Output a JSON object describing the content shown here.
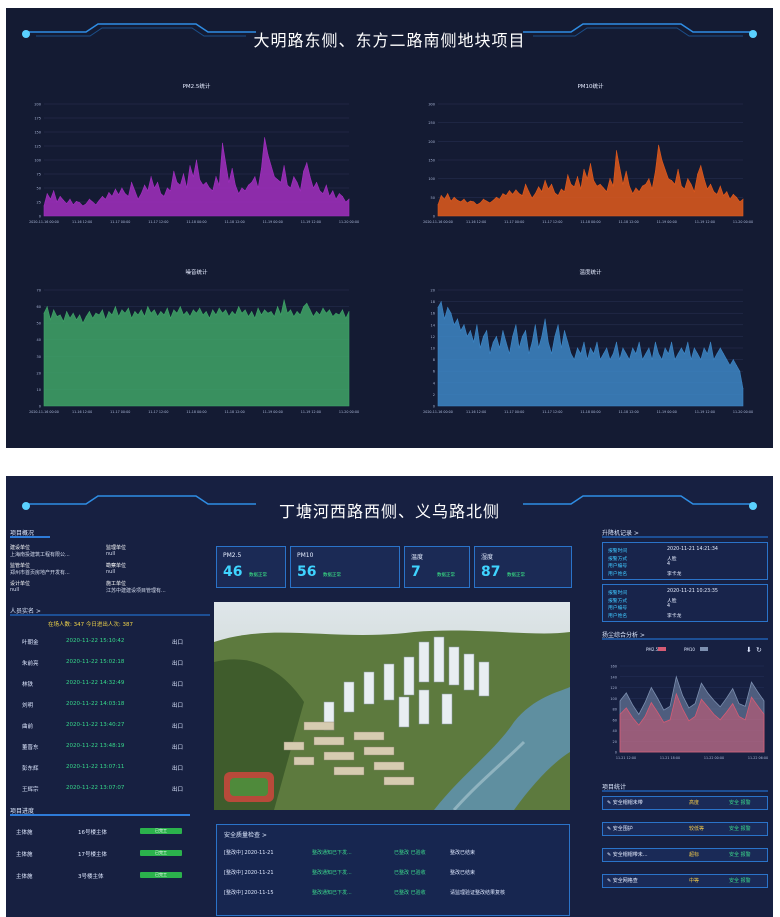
{
  "panel1": {
    "title": "大明路东侧、东方二路南侧地块项目",
    "charts": [
      {
        "title": "PM2.5统计",
        "color": "#a22fc0",
        "ylim": [
          0,
          200
        ],
        "yticks": [
          "0",
          "25",
          "50",
          "75",
          "100",
          "125",
          "150",
          "175",
          "200"
        ],
        "xticks": [
          "2020-11-16 00:00",
          "11-16 12:00",
          "11-17 00:00",
          "11-17 12:00",
          "11-18 00:00",
          "11-18 12:00",
          "11-19 00:00",
          "11-19 12:00",
          "11-20 00:00"
        ],
        "values": [
          18,
          40,
          30,
          45,
          25,
          35,
          28,
          22,
          30,
          20,
          26,
          24,
          18,
          22,
          30,
          25,
          20,
          28,
          35,
          30,
          42,
          35,
          48,
          38,
          50,
          40,
          35,
          60,
          45,
          30,
          40,
          55,
          45,
          70,
          50,
          60,
          40,
          35,
          50,
          45,
          80,
          60,
          55,
          75,
          50,
          90,
          70,
          100,
          65,
          55,
          60,
          50,
          45,
          70,
          55,
          130,
          95,
          60,
          85,
          55,
          40,
          50,
          45,
          55,
          60,
          70,
          50,
          85,
          140,
          110,
          90,
          70,
          65,
          60,
          90,
          55,
          50,
          70,
          60,
          45,
          80,
          95,
          70,
          50,
          60,
          45,
          40,
          55,
          35,
          45,
          30,
          40,
          35,
          25,
          30
        ]
      },
      {
        "title": "PM10统计",
        "color": "#e25a1c",
        "ylim": [
          0,
          300
        ],
        "yticks": [
          "0",
          "50",
          "100",
          "150",
          "200",
          "250",
          "300"
        ],
        "xticks": [
          "2020-11-16 00:00",
          "11-16 12:00",
          "11-17 00:00",
          "11-17 12:00",
          "11-18 00:00",
          "11-18 12:00",
          "11-19 00:00",
          "11-19 12:00",
          "11-20 00:00"
        ],
        "values": [
          30,
          55,
          45,
          60,
          40,
          50,
          42,
          38,
          45,
          35,
          40,
          38,
          30,
          35,
          45,
          40,
          35,
          42,
          50,
          45,
          60,
          55,
          68,
          58,
          70,
          60,
          55,
          85,
          65,
          48,
          60,
          78,
          65,
          95,
          72,
          85,
          62,
          55,
          72,
          65,
          110,
          85,
          78,
          105,
          72,
          125,
          100,
          140,
          95,
          80,
          85,
          75,
          65,
          100,
          80,
          175,
          130,
          85,
          120,
          80,
          60,
          75,
          65,
          80,
          85,
          100,
          72,
          120,
          190,
          150,
          125,
          100,
          95,
          85,
          125,
          80,
          72,
          100,
          85,
          65,
          112,
          135,
          100,
          72,
          85,
          65,
          58,
          80,
          55,
          65,
          45,
          58,
          50,
          38,
          45
        ]
      },
      {
        "title": "噪音统计",
        "color": "#3fa567",
        "ylim": [
          0,
          70
        ],
        "yticks": [
          "0",
          "10",
          "20",
          "30",
          "40",
          "50",
          "60",
          "70"
        ],
        "xticks": [
          "2020-11-16 00:00",
          "11-16 12:00",
          "11-17 00:00",
          "11-17 12:00",
          "11-18 00:00",
          "11-18 12:00",
          "11-19 00:00",
          "11-19 12:00",
          "11-20 00:00"
        ],
        "values": [
          56,
          60,
          52,
          58,
          54,
          55,
          51,
          57,
          53,
          56,
          52,
          55,
          50,
          54,
          57,
          53,
          56,
          55,
          58,
          52,
          57,
          55,
          60,
          54,
          58,
          56,
          59,
          53,
          57,
          55,
          58,
          54,
          60,
          56,
          58,
          54,
          57,
          55,
          59,
          53,
          58,
          56,
          60,
          55,
          57,
          54,
          58,
          56,
          59,
          55,
          57,
          53,
          58,
          55,
          59,
          56,
          58,
          54,
          57,
          55,
          60,
          56,
          58,
          54,
          57,
          53,
          59,
          55,
          58,
          56,
          57,
          54,
          60,
          55,
          64,
          56,
          58,
          54,
          57,
          55,
          60,
          62,
          58,
          54,
          57,
          55,
          59,
          56,
          58,
          54,
          56,
          55,
          58,
          53,
          57
        ]
      },
      {
        "title": "温度统计",
        "color": "#3d86c6",
        "ylim": [
          0,
          20
        ],
        "yticks": [
          "0",
          "2",
          "4",
          "6",
          "8",
          "10",
          "12",
          "14",
          "16",
          "18",
          "20"
        ],
        "xticks": [
          "2020-11-16 00:00",
          "11-16 12:00",
          "11-17 00:00",
          "11-17 12:00",
          "11-18 00:00",
          "11-18 12:00",
          "11-19 00:00",
          "11-19 12:00",
          "11-20 00:00"
        ],
        "values": [
          17,
          18,
          15,
          17,
          16,
          14,
          15,
          13,
          14,
          12,
          13,
          11,
          14,
          10,
          12,
          13,
          9,
          11,
          12,
          10,
          13,
          11,
          9,
          12,
          14,
          10,
          12,
          13,
          9,
          11,
          14,
          10,
          12,
          15,
          11,
          9,
          12,
          14,
          10,
          13,
          11,
          9,
          8,
          10,
          9,
          11,
          8,
          10,
          9,
          11,
          8,
          9,
          10,
          8,
          9,
          11,
          8,
          10,
          9,
          8,
          10,
          9,
          11,
          8,
          9,
          10,
          8,
          11,
          9,
          8,
          10,
          9,
          11,
          8,
          9,
          10,
          9,
          11,
          8,
          10,
          9,
          8,
          10,
          9,
          11,
          8,
          9,
          10,
          9,
          8,
          7,
          8,
          7,
          6,
          3
        ]
      }
    ]
  },
  "panel2": {
    "title": "丁塘河西路西侧、义乌路北侧",
    "overview": {
      "heading": "项目概况",
      "fields": [
        {
          "label": "建设单位",
          "value": "上海南投建筑工程有限公..."
        },
        {
          "label": "监理单位",
          "value": "null"
        },
        {
          "label": "监管单位",
          "value": "郑州市首页房地产开发有..."
        },
        {
          "label": "勘察单位",
          "value": "null"
        },
        {
          "label": "设计单位",
          "value": "null"
        },
        {
          "label": "施工单位",
          "value": "江苏中建建设项目管理有..."
        }
      ]
    },
    "attendance": {
      "heading": "人员实名 >",
      "summary": "在场人数: 347  今日进出人次: 387",
      "rows": [
        {
          "name": "叶朝金",
          "time": "2020-11-22 15:10:42",
          "dir": "出口"
        },
        {
          "name": "朱前亮",
          "time": "2020-11-22 15:02:18",
          "dir": "出口"
        },
        {
          "name": "林铁",
          "time": "2020-11-22 14:32:49",
          "dir": "出口"
        },
        {
          "name": "刘明",
          "time": "2020-11-22 14:03:18",
          "dir": "出口"
        },
        {
          "name": "曲前",
          "time": "2020-11-22 13:40:27",
          "dir": "出口"
        },
        {
          "name": "董晋东",
          "time": "2020-11-22 13:48:19",
          "dir": "出口"
        },
        {
          "name": "彭东辉",
          "time": "2020-11-22 13:07:11",
          "dir": "出口"
        },
        {
          "name": "王辉宗",
          "time": "2020-11-22 13:07:07",
          "dir": "出口"
        }
      ]
    },
    "progress": {
      "heading": "项目进度",
      "rows": [
        {
          "name": "主体施",
          "item": "16号楼主体",
          "status": "已完工"
        },
        {
          "name": "主体施",
          "item": "17号楼主体",
          "status": "已完工"
        },
        {
          "name": "主体施",
          "item": "3号楼主体",
          "status": "已完工"
        }
      ]
    },
    "stats": [
      {
        "name": "PM2.5",
        "value": "46",
        "tag": "数据正常"
      },
      {
        "name": "PM10",
        "value": "56",
        "tag": "数据正常"
      },
      {
        "name": "温度",
        "value": "7",
        "tag": "数据正常"
      },
      {
        "name": "湿度",
        "value": "87",
        "tag": "数据正常"
      }
    ],
    "safety": {
      "heading": "安全质量检查 >",
      "rows": [
        {
          "date": "[整改中] 2020-11-21",
          "desc": "整改通知已下发...",
          "status": "已整改 已验收",
          "result": "整改已结束"
        },
        {
          "date": "[整改中] 2020-11-21",
          "desc": "整改通知已下发...",
          "status": "已整改 已验收",
          "result": "整改已结束"
        },
        {
          "date": "[整改中] 2020-11-15",
          "desc": "整改通知已下发...",
          "status": "已整改 已验收",
          "result": "请监理验证整改结果复核"
        }
      ]
    },
    "alarm": {
      "heading": "升降机记录 >",
      "records": [
        {
          "labels": [
            "报警时间",
            "报警方式",
            "用户编号",
            "用户姓名"
          ],
          "values": [
            "2020-11-21 14:21:34",
            "人脸",
            "4",
            "李卡龙"
          ]
        },
        {
          "labels": [
            "报警时间",
            "报警方式",
            "用户编号",
            "用户姓名"
          ],
          "values": [
            "2020-11-21 10:23:35",
            "人脸",
            "4",
            "李卡龙"
          ]
        }
      ]
    },
    "dust": {
      "heading": "扬尘综合分析 >",
      "legend": [
        "PM2.5",
        "PM10"
      ],
      "legend_colors": [
        "#d65b74",
        "#7c8fb0"
      ],
      "ylim": [
        0,
        160
      ],
      "yticks": [
        "0",
        "20",
        "40",
        "60",
        "80",
        "100",
        "120",
        "140",
        "160"
      ],
      "xticks": [
        "11-21 12:00",
        "11-21 18:00",
        "11-22 00:00",
        "11-22 06:00"
      ],
      "pm10": [
        95,
        110,
        88,
        70,
        92,
        120,
        100,
        78,
        85,
        140,
        105,
        82,
        90,
        128,
        110,
        96,
        84,
        100,
        118,
        90,
        85,
        130,
        112,
        95
      ],
      "pm25": [
        70,
        82,
        64,
        50,
        66,
        92,
        74,
        55,
        60,
        108,
        80,
        58,
        66,
        98,
        84,
        70,
        60,
        74,
        90,
        66,
        60,
        102,
        86,
        70
      ]
    },
    "risk": {
      "heading": "项目统计",
      "rows": [
        {
          "name": "安全帽帽未带",
          "level": "高度",
          "state": "安全 报警"
        },
        {
          "name": "安全围护",
          "level": "较低等",
          "state": "安全 报警"
        },
        {
          "name": "安全帽帽带未...",
          "level": "超标",
          "state": "安全 报警"
        },
        {
          "name": "安全网格查",
          "level": "中等",
          "state": "安全 报警"
        }
      ]
    }
  }
}
